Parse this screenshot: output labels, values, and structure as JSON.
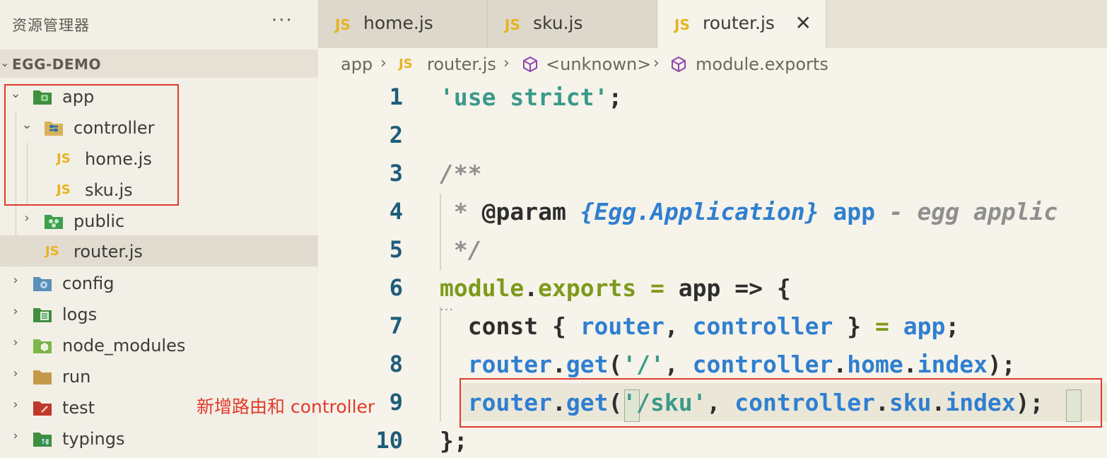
{
  "explorer": {
    "title": "资源管理器",
    "more": "···",
    "project": "EGG-DEMO",
    "project_chevron": "⌄",
    "tree": [
      {
        "label": "app",
        "chevron": "⌄",
        "icon": "folder-app-icon"
      },
      {
        "label": "controller",
        "chevron": "⌄",
        "icon": "folder-controller-icon"
      },
      {
        "label": "home.js",
        "icon": "js-file-icon"
      },
      {
        "label": "sku.js",
        "icon": "js-file-icon"
      },
      {
        "label": "public",
        "chevron": "›",
        "icon": "folder-public-icon"
      },
      {
        "label": "router.js",
        "icon": "js-file-icon"
      },
      {
        "label": "config",
        "chevron": "›",
        "icon": "folder-config-icon"
      },
      {
        "label": "logs",
        "chevron": "›",
        "icon": "folder-logs-icon"
      },
      {
        "label": "node_modules",
        "chevron": "›",
        "icon": "folder-node-icon"
      },
      {
        "label": "run",
        "chevron": "›",
        "icon": "folder-run-icon"
      },
      {
        "label": "test",
        "chevron": "›",
        "icon": "folder-test-icon"
      },
      {
        "label": "typings",
        "chevron": "›",
        "icon": "folder-typings-icon"
      }
    ]
  },
  "js_badge": "JS",
  "annotation": "新增路由和 controller",
  "tabs": [
    {
      "label": "home.js",
      "active": false
    },
    {
      "label": "sku.js",
      "active": false
    },
    {
      "label": "router.js",
      "active": true,
      "close": "✕"
    }
  ],
  "breadcrumb": {
    "items": [
      "app",
      "router.js",
      "<unknown>",
      "module.exports"
    ],
    "sep": "›"
  },
  "editor": {
    "line_numbers": [
      "1",
      "2",
      "3",
      "4",
      "5",
      "6",
      "7",
      "8",
      "9",
      "10"
    ],
    "lines": [
      {
        "parts": [
          [
            "k-str",
            "'use strict'"
          ],
          [
            "k-dark",
            ";"
          ]
        ]
      },
      {
        "parts": []
      },
      {
        "parts": [
          [
            "k-com",
            "/**"
          ]
        ]
      },
      {
        "parts": [
          [
            "k-com",
            " * "
          ],
          [
            "k-dark",
            "@param "
          ],
          [
            "k-type",
            "{Egg.Application}"
          ],
          [
            "k-com",
            " "
          ],
          [
            "k-ident",
            "app"
          ],
          [
            "k-com",
            " - egg applic"
          ]
        ]
      },
      {
        "parts": [
          [
            "k-com",
            " */"
          ]
        ]
      },
      {
        "parts": [
          [
            "k-mod",
            "module"
          ],
          [
            "k-dark",
            "."
          ],
          [
            "k-mod",
            "exports"
          ],
          [
            "k-op",
            " = "
          ],
          [
            "k-dark",
            "app => {"
          ]
        ]
      },
      {
        "parts": [
          [
            "k-dark",
            "  const { "
          ],
          [
            "k-ident",
            "router"
          ],
          [
            "k-dark",
            ", "
          ],
          [
            "k-ident",
            "controller"
          ],
          [
            "k-dark",
            " } "
          ],
          [
            "k-op",
            "="
          ],
          [
            "k-dark",
            " "
          ],
          [
            "k-ident",
            "app"
          ],
          [
            "k-dark",
            ";"
          ]
        ]
      },
      {
        "parts": [
          [
            "k-ident",
            "  router"
          ],
          [
            "k-dark",
            "."
          ],
          [
            "k-ident",
            "get"
          ],
          [
            "k-dark",
            "("
          ],
          [
            "k-str",
            "'/'"
          ],
          [
            "k-dark",
            ", "
          ],
          [
            "k-ident",
            "controller"
          ],
          [
            "k-dark",
            "."
          ],
          [
            "k-ident",
            "home"
          ],
          [
            "k-dark",
            "."
          ],
          [
            "k-ident",
            "index"
          ],
          [
            "k-dark",
            ");"
          ]
        ]
      },
      {
        "parts": [
          [
            "k-ident",
            "  router"
          ],
          [
            "k-dark",
            "."
          ],
          [
            "k-ident",
            "get"
          ],
          [
            "k-dark",
            "("
          ],
          [
            "k-str",
            "'/sku'"
          ],
          [
            "k-dark",
            ", "
          ],
          [
            "k-ident",
            "controller"
          ],
          [
            "k-dark",
            "."
          ],
          [
            "k-ident",
            "sku"
          ],
          [
            "k-dark",
            "."
          ],
          [
            "k-ident",
            "index"
          ],
          [
            "k-dark",
            ");"
          ]
        ]
      },
      {
        "parts": [
          [
            "k-dark",
            "};"
          ]
        ]
      }
    ]
  },
  "colors": {
    "highlight": "#e03a2a",
    "js_yellow": "#e6b422"
  }
}
